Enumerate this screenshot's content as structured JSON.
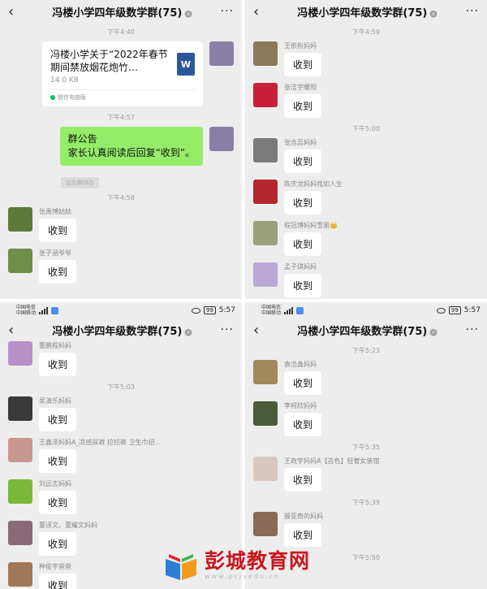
{
  "panels": [
    {
      "title": "冯楼小学四年级数学群(75)",
      "items": [
        {
          "type": "time",
          "text": "下午4:40"
        },
        {
          "type": "file",
          "side": "right",
          "avatar": "#8a7fa8",
          "title": "冯楼小学关于“2022年春节期间禁放烟花炮竹…",
          "size": "14.0 KB",
          "icon": "W",
          "source": "微信电脑版"
        },
        {
          "type": "time",
          "text": "下午4:57"
        },
        {
          "type": "announce",
          "side": "right",
          "avatar": "#8a7fa8",
          "line1": "群公告",
          "line2": "家长认真阅读后回复“收到”。"
        },
        {
          "type": "setby",
          "text": "设为群待办"
        },
        {
          "type": "time",
          "text": "下午4:58"
        },
        {
          "type": "msg",
          "side": "left",
          "avatar": "#5b7a3c",
          "sender": "张禹博姑姑",
          "text": "收到"
        },
        {
          "type": "msg",
          "side": "left",
          "avatar": "#6e8f4a",
          "sender": "张子涵爷爷",
          "text": "收到"
        }
      ]
    },
    {
      "title": "冯楼小学四年级数学群(75)",
      "items": [
        {
          "type": "time",
          "text": "下午4:59"
        },
        {
          "type": "msg",
          "side": "left",
          "avatar": "#8a7a5a",
          "sender": "王依彤妈妈",
          "text": "收到"
        },
        {
          "type": "msg",
          "side": "left",
          "avatar": "#c8203a",
          "sender": "张洁宇暖阳",
          "text": "收到"
        },
        {
          "type": "time",
          "text": "下午5:00"
        },
        {
          "type": "msg",
          "side": "left",
          "avatar": "#7a7a7a",
          "sender": "张含蕊妈妈",
          "text": "收到"
        },
        {
          "type": "msg",
          "side": "left",
          "avatar": "#b3262e",
          "sender": "陈庆龙妈妈戏如人生",
          "text": "收到"
        },
        {
          "type": "msg",
          "side": "left",
          "avatar": "#9aa07a",
          "sender": "程冠博妈妈雪丽👑",
          "text": "收到"
        },
        {
          "type": "msg",
          "side": "left",
          "avatar": "#b9a8d8",
          "sender": "孟子琪妈妈",
          "text": "收到"
        }
      ]
    },
    {
      "status": {
        "carrier1": "中国电信",
        "carrier2": "中国移动",
        "battery": "99",
        "clock": "5:57"
      },
      "title": "冯楼小学四年级数学群(75)",
      "items": [
        {
          "type": "msg",
          "side": "left",
          "avatar": "#b890c8",
          "sender": "董鹏程妈妈",
          "text": "收到"
        },
        {
          "type": "time",
          "text": "下午5:03"
        },
        {
          "type": "msg",
          "side": "left",
          "avatar": "#3a3a3a",
          "sender": "吴演乐妈妈",
          "text": "收到"
        },
        {
          "type": "msg",
          "side": "left",
          "avatar": "#c89890",
          "sender": "王鑫泽妈妈A_凉感尿裤 拉拉裤 卫生巾招...",
          "text": "收到"
        },
        {
          "type": "msg",
          "side": "left",
          "avatar": "#7ab83a",
          "sender": "刘远志妈妈",
          "text": "收到"
        },
        {
          "type": "msg",
          "side": "left",
          "avatar": "#8a6a78",
          "sender": "董译文、董耀文妈妈",
          "text": "收到"
        },
        {
          "type": "msg",
          "side": "left",
          "avatar": "#a07858",
          "sender": "种俊宇爸爸",
          "text": "收到"
        }
      ]
    },
    {
      "status": {
        "carrier1": "中国电信",
        "carrier2": "中国移动",
        "battery": "99",
        "clock": "5:57"
      },
      "title": "冯楼小学四年级数学群(75)",
      "items": [
        {
          "type": "time",
          "text": "下午5:23"
        },
        {
          "type": "msg",
          "side": "left",
          "avatar": "#a08a5a",
          "sender": "袁浩鑫妈妈",
          "text": "收到"
        },
        {
          "type": "msg",
          "side": "left",
          "avatar": "#4a5a3a",
          "sender": "李柯欣妈妈",
          "text": "收到"
        },
        {
          "type": "time",
          "text": "下午5:35"
        },
        {
          "type": "msg",
          "side": "left",
          "avatar": "#d8c8c0",
          "sender": "王政宇妈妈A【古色】轻奢女装馆",
          "text": "收到"
        },
        {
          "type": "time",
          "text": "下午5:39"
        },
        {
          "type": "msg",
          "side": "left",
          "avatar": "#8a6a58",
          "sender": "滕亚奇的妈妈",
          "text": "收到"
        },
        {
          "type": "time",
          "text": "下午5:50"
        }
      ]
    }
  ],
  "watermark": {
    "name": "彭城教育网",
    "url": "www.pcjyedu.cn"
  }
}
